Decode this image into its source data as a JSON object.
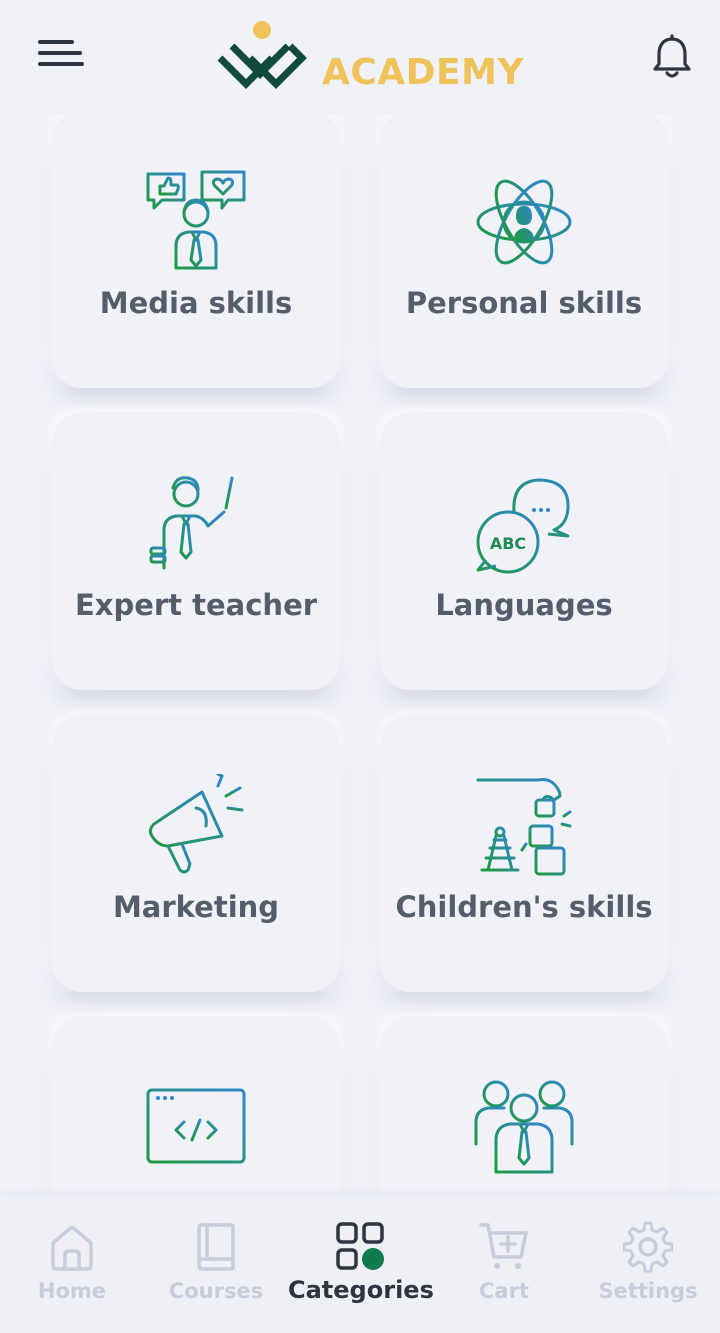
{
  "header": {
    "logo_text": "ACADEMY",
    "menu_icon": "hamburger-menu-icon",
    "notification_icon": "bell-icon"
  },
  "categories": [
    {
      "label": "Media skills",
      "icon": "social-media-person-icon"
    },
    {
      "label": "Personal skills",
      "icon": "atom-person-icon"
    },
    {
      "label": "Expert teacher",
      "icon": "teacher-pointer-icon"
    },
    {
      "label": "Languages",
      "icon": "abc-speech-bubbles-icon"
    },
    {
      "label": "Marketing",
      "icon": "megaphone-icon"
    },
    {
      "label": "Children's skills",
      "icon": "building-blocks-icon"
    },
    {
      "label": "",
      "icon": "code-window-icon"
    },
    {
      "label": "",
      "icon": "team-people-icon"
    }
  ],
  "tabbar": {
    "tabs": [
      {
        "label": "Home",
        "icon": "home-icon",
        "active": false
      },
      {
        "label": "Courses",
        "icon": "book-icon",
        "active": false
      },
      {
        "label": "Categories",
        "icon": "categories-grid-icon",
        "active": true
      },
      {
        "label": "Cart",
        "icon": "cart-icon",
        "active": false
      },
      {
        "label": "Settings",
        "icon": "gear-icon",
        "active": false
      }
    ]
  },
  "colors": {
    "brand_dark_green": "#0f4a3a",
    "brand_yellow": "#f0c25a",
    "icon_green": "#1e9a3c",
    "icon_blue": "#2f86d0",
    "active_dot": "#0f7a4e",
    "label_text": "#555d6c",
    "inactive_tab": "#c6ccd9",
    "background": "#f0f2f8"
  }
}
